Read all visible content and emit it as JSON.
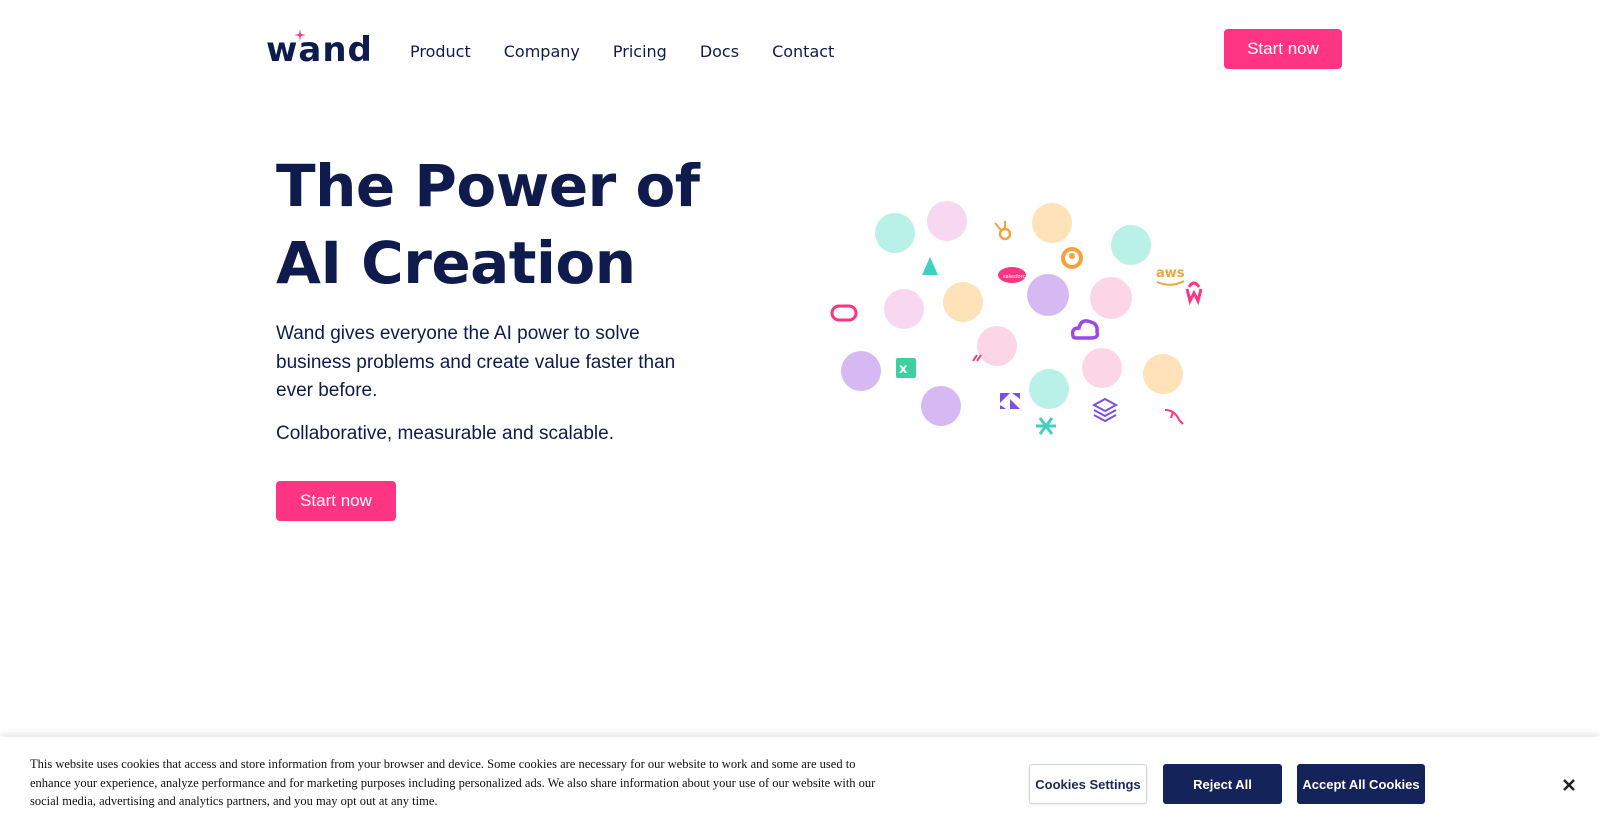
{
  "header": {
    "logo_text": "wand",
    "nav": [
      {
        "label": "Product"
      },
      {
        "label": "Company"
      },
      {
        "label": "Pricing"
      },
      {
        "label": "Docs"
      },
      {
        "label": "Contact"
      }
    ],
    "cta_label": "Start now"
  },
  "hero": {
    "title_line1": "The Power of",
    "title_line2": "AI Creation",
    "description": "Wand gives everyone the AI power to solve business problems and create value faster than ever before.",
    "subtext": "Collaborative, measurable and scalable.",
    "cta_label": "Start now"
  },
  "illustration": {
    "integration_icons": [
      "hubspot-icon",
      "aws-icon",
      "salesforce-icon",
      "looker-icon",
      "oracle-icon",
      "excel-icon",
      "zendesk-icon",
      "snowflake-icon",
      "databricks-icon",
      "mysql-icon",
      "google-cloud-icon",
      "w-icon"
    ],
    "aws_text": "aws"
  },
  "cookie_banner": {
    "text": "This website uses cookies that access and store information from your browser and device. Some cookies are necessary for our website to work and some are used to enhance your experience, analyze performance and for marketing purposes including personalized ads. We also share information about your use of our website with our social media, advertising and analytics partners, and you may opt out at any time.",
    "settings_label": "Cookies Settings",
    "reject_label": "Reject All",
    "accept_label": "Accept All Cookies"
  },
  "colors": {
    "brand_navy": "#0f1b4c",
    "brand_pink": "#ff3583",
    "button_navy": "#14245a"
  }
}
